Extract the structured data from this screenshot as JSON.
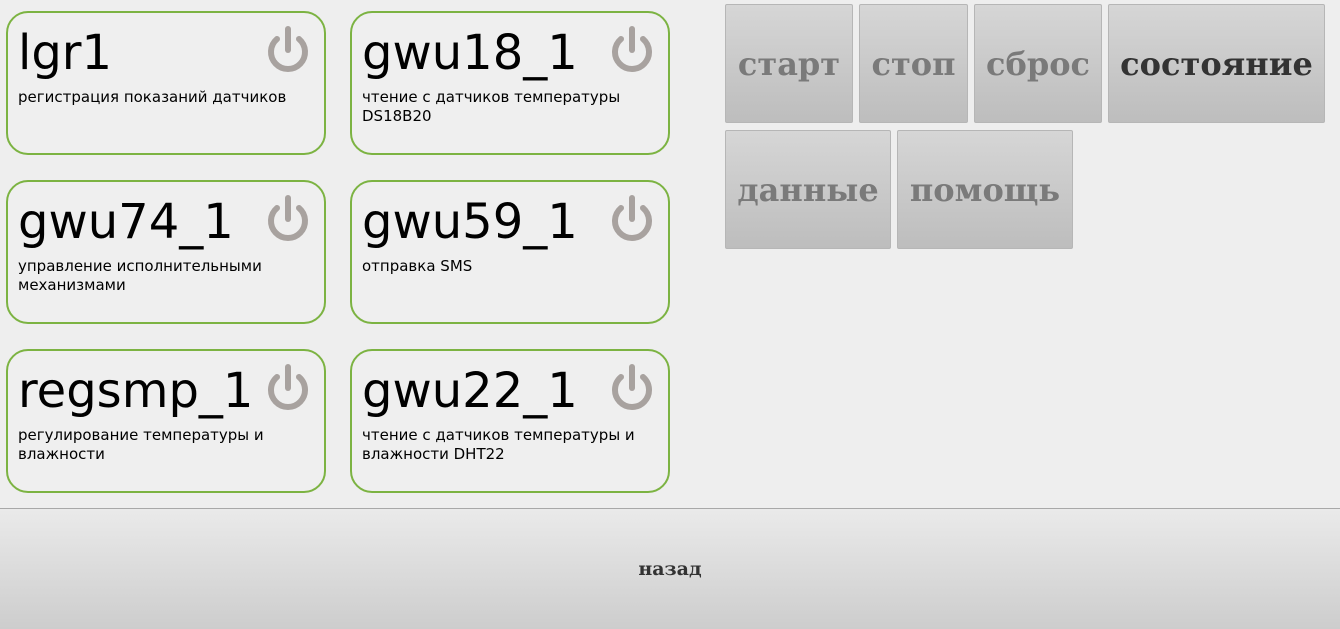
{
  "colors": {
    "card_border": "#7cb342",
    "power_icon": "#a8a29f",
    "button_text": "#7a7a7a",
    "button_text_active": "#333333"
  },
  "programs": [
    {
      "name": "lgr1",
      "description": "регистрация показаний датчиков",
      "icon": "power-icon"
    },
    {
      "name": "gwu18_1",
      "description": "чтение с датчиков температуры DS18B20",
      "icon": "power-icon"
    },
    {
      "name": "gwu74_1",
      "description": "управление исполнительными механизмами",
      "icon": "power-icon"
    },
    {
      "name": "gwu59_1",
      "description": "отправка SMS",
      "icon": "power-icon"
    },
    {
      "name": "regsmp_1",
      "description": "регулирование температуры и влажности",
      "icon": "power-icon"
    },
    {
      "name": "gwu22_1",
      "description": "чтение с датчиков температуры и влажности DHT22",
      "icon": "power-icon"
    }
  ],
  "commands": {
    "start": "старт",
    "stop": "стоп",
    "reset": "сброс",
    "status": "состояние",
    "data": "данные",
    "help": "помощь"
  },
  "footer": {
    "back_label": "назад"
  }
}
